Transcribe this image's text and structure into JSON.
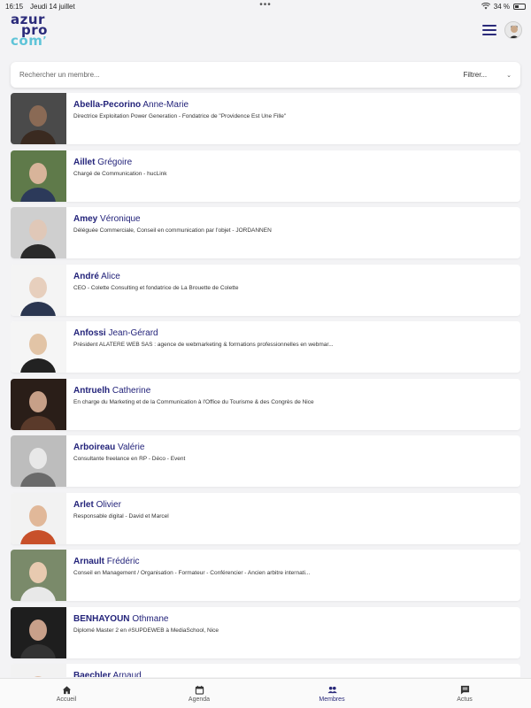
{
  "status": {
    "time": "16:15",
    "date": "Jeudi 14 juillet",
    "dots": "•••",
    "battery": "34 %"
  },
  "logo": {
    "line1": "azur",
    "line2": "pro",
    "line3": "com",
    "accent": "’"
  },
  "search": {
    "placeholder": "Rechercher un membre...",
    "value": "",
    "filter_label": "Filtrer..."
  },
  "members": [
    {
      "last": "Abella-Pecorino",
      "first": "Anne-Marie",
      "desc": "Directrice Exploitation Power Generation - Fondatrice de \"Providence Est Une Fille\""
    },
    {
      "last": "Aillet",
      "first": "Grégoire",
      "desc": "Chargé de Communication - hucLink"
    },
    {
      "last": "Amey",
      "first": "Véronique",
      "desc": "Déléguée Commerciale, Conseil en communication par l'objet - JORDANNEN"
    },
    {
      "last": "André",
      "first": "Alice",
      "desc": "CEO - Colette Consulting et fondatrice de La Brouette de Colette"
    },
    {
      "last": "Anfossi",
      "first": "Jean-Gérard",
      "desc": "Président ALATERE WEB SAS : agence de webmarketing & formations professionnelles en webmar..."
    },
    {
      "last": "Antruelh",
      "first": "Catherine",
      "desc": "En charge du Marketing et de la Communication à l'Office du Tourisme & des Congrès de Nice"
    },
    {
      "last": "Arboireau",
      "first": "Valérie",
      "desc": "Consultante freelance en  RP - Déco - Event"
    },
    {
      "last": "Arlet",
      "first": "Olivier",
      "desc": "Responsable digital - David et Marcel"
    },
    {
      "last": "Arnault",
      "first": "Frédéric",
      "desc": "Conseil en Management / Organisation - Formateur - Conférencier - Ancien arbitre internati..."
    },
    {
      "last": "BENHAYOUN",
      "first": "Othmane",
      "desc": "Diplomé Master 2 en #SUPDEWEB à MediaSchool, Nice"
    },
    {
      "last": "Baechler",
      "first": "Arnaud",
      "desc": ""
    }
  ],
  "tabs": [
    {
      "label": "Accueil",
      "icon": "home-icon",
      "active": false
    },
    {
      "label": "Agenda",
      "icon": "calendar-icon",
      "active": false
    },
    {
      "label": "Membres",
      "icon": "people-icon",
      "active": true
    },
    {
      "label": "Actus",
      "icon": "news-icon",
      "active": false
    }
  ],
  "colors": {
    "brand": "#2a2a7a",
    "accent": "#5fc4d8",
    "background": "#f3f3f5"
  }
}
